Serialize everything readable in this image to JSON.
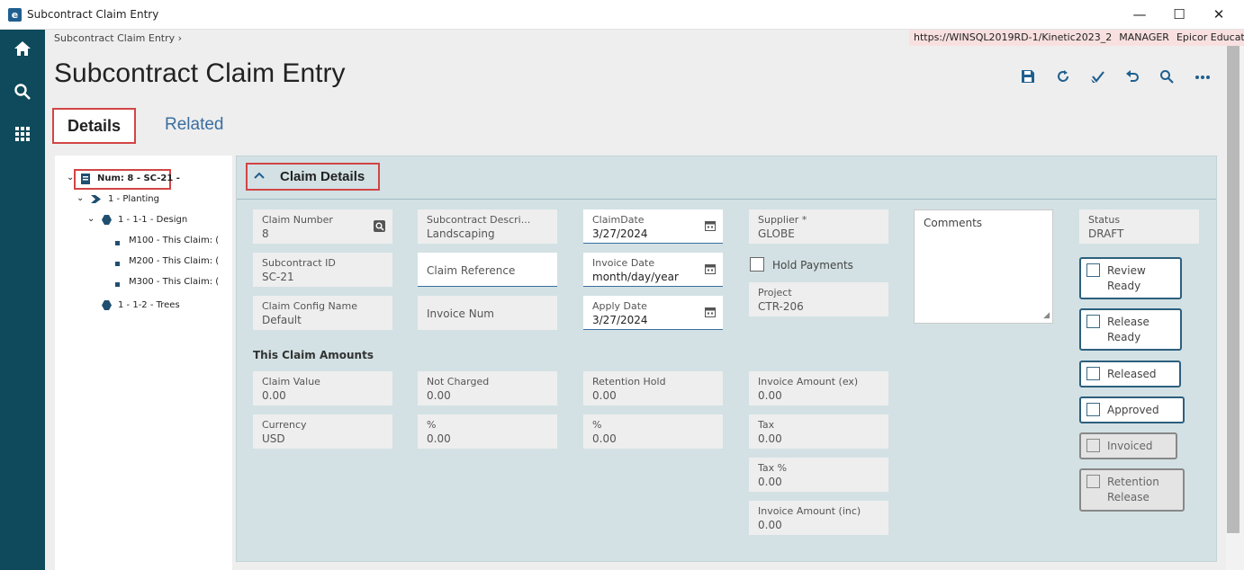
{
  "window": {
    "title": "Subcontract Claim Entry",
    "minimize": "—",
    "maximize": "☐",
    "close": "✕"
  },
  "breadcrumb": {
    "label": "Subcontract Claim Entry",
    "sep": "›"
  },
  "context": {
    "url": "https://WINSQL2019RD-1/Kinetic2023_2",
    "user": "MANAGER",
    "company": "Epicor Education"
  },
  "page": {
    "title": "Subcontract Claim Entry"
  },
  "tabs": {
    "details": "Details",
    "related": "Related"
  },
  "tree": {
    "root": "Num: 8 - SC-21 -",
    "level1": "1 - Planting",
    "level2a": "1 - 1-1 - Design",
    "items": [
      "M100 - This Claim: (",
      "M200 - This Claim: (",
      "M300 - This Claim: ("
    ],
    "level2b": "1 - 1-2 - Trees"
  },
  "panel": {
    "title": "Claim Details"
  },
  "fields": {
    "claim_number": {
      "label": "Claim Number",
      "value": "8"
    },
    "subcontract_desc": {
      "label": "Subcontract Descri...",
      "value": "Landscaping"
    },
    "claim_date": {
      "label": "ClaimDate",
      "value": "3/27/2024"
    },
    "supplier": {
      "label": "Supplier *",
      "value": "GLOBE"
    },
    "status": {
      "label": "Status",
      "value": "DRAFT"
    },
    "subcontract_id": {
      "label": "Subcontract ID",
      "value": "SC-21"
    },
    "claim_reference": {
      "placeholder": "Claim Reference"
    },
    "invoice_date": {
      "label": "Invoice Date",
      "value": "month/day/year"
    },
    "hold_payments": {
      "label": "Hold Payments"
    },
    "claim_config": {
      "label": "Claim Config Name",
      "value": "Default"
    },
    "invoice_num": {
      "placeholder": "Invoice Num"
    },
    "apply_date": {
      "label": "Apply Date",
      "value": "3/27/2024"
    },
    "project": {
      "label": "Project",
      "value": "CTR-206"
    },
    "comments": {
      "placeholder": "Comments"
    }
  },
  "section": {
    "title": "This Claim Amounts"
  },
  "amounts": {
    "claim_value": {
      "label": "Claim Value",
      "value": "0.00"
    },
    "not_charged": {
      "label": "Not Charged",
      "value": "0.00"
    },
    "retention_hold": {
      "label": "Retention Hold",
      "value": "0.00"
    },
    "invoice_amount_ex": {
      "label": "Invoice Amount (ex)",
      "value": "0.00"
    },
    "currency": {
      "label": "Currency",
      "value": "USD"
    },
    "nc_pct": {
      "label": "%",
      "value": "0.00"
    },
    "rh_pct": {
      "label": "%",
      "value": "0.00"
    },
    "tax": {
      "label": "Tax",
      "value": "0.00"
    },
    "tax_pct": {
      "label": "Tax %",
      "value": "0.00"
    },
    "invoice_amount_inc": {
      "label": "Invoice Amount (inc)",
      "value": "0.00"
    }
  },
  "status_buttons": {
    "review_ready": "Review Ready",
    "release_ready": "Release Ready",
    "released": "Released",
    "approved": "Approved",
    "invoiced": "Invoiced",
    "retention_release": "Retention Release"
  },
  "icons": {
    "home": "home-icon",
    "search": "search-icon",
    "apps": "grid-icon",
    "save": "save-icon",
    "refresh": "refresh-icon",
    "clear": "clear-icon",
    "undo": "undo-icon",
    "find": "search-icon",
    "more": "more-icon"
  },
  "colors": {
    "sidebar": "#0e4a5b",
    "accent": "#1f5f8f",
    "highlight": "#d24545",
    "panel": "#d3e1e4"
  }
}
